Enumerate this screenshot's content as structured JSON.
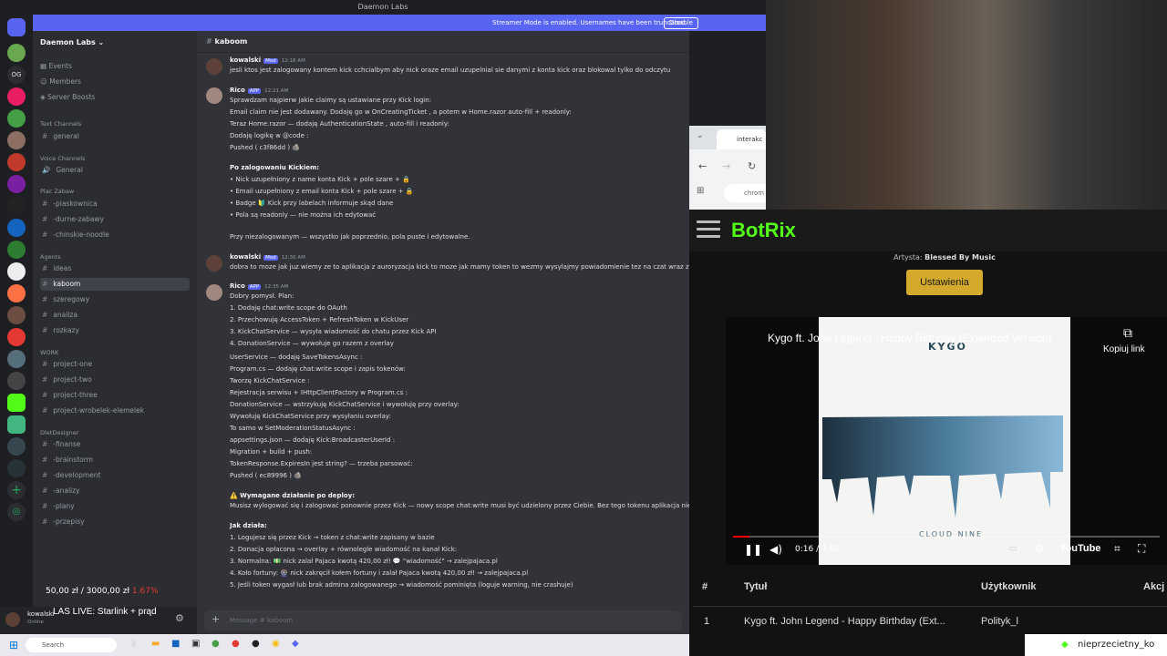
{
  "window": {
    "title": "Daemon Labs"
  },
  "banner": {
    "text": "Streamer Mode is enabled. Usernames have been truncated.",
    "button": "Disable"
  },
  "server": {
    "name": "Daemon Labs"
  },
  "nav": [
    "Events",
    "Members",
    "Server Boosts"
  ],
  "categories": {
    "text": "Text Channels",
    "voice": "Voice Channels",
    "plac": "Plac Zabaw",
    "agents": "Agents",
    "work": "WORK",
    "dlet": "DletDesigner"
  },
  "channels": {
    "general": "general",
    "voice_general": "General",
    "piaskownica": "-piaskownica",
    "durne": "-durne-zabawy",
    "chinskie": "-chinskie-noodle",
    "ideas": "ideas",
    "kaboom": "kaboom",
    "szeregowy": "szeregowy",
    "analiza": "analiza",
    "rozkazy": "rozkazy",
    "p1": "project-one",
    "p2": "project-two",
    "p3": "project-three",
    "p4": "project-wrobelek-elemelek",
    "finanse": "-finanse",
    "brainstorm": "-brainstorm",
    "development": "-development",
    "analizy": "-analizy",
    "plany": "-plany",
    "przepisy": "-przepisy"
  },
  "chat": {
    "channel": "kaboom",
    "placeholder": "Message # kaboom",
    "msgs": {
      "u1": "kowalski",
      "u1tag": "Mod",
      "t1": "12:18 AM",
      "l1": "jesli ktos jest zalogowany kontem kick cchcialbym aby nick oraze email uzupelnial sie danymi z konta kick  oraz blokowal tylko do odczytu",
      "u2": "Rico",
      "u2tag": "APP",
      "t2": "12:21 AM",
      "l2": "Sprawdzam najpierw jakie claimy są ustawiane przy Kick login:",
      "l3": "Email claim nie jest dodawany. Dodaję go w OnCreatingTicket , a potem w Home.razor auto-fill + readonly:",
      "l4": "Teraz Home.razor — dodaję AuthenticationState , auto-fill i readonly:",
      "l5": "Dodaję logikę w @code :",
      "l6": "Pushed ( c3f86dd ) 🪨",
      "l7": "Po zalogowaniu Kickiem:",
      "l8": "• Nick uzupełniony z name konta Kick + pole szare + 🔒",
      "l9": "• Email uzupełniony z email konta Kick + pole szare + 🔒",
      "l10": "• Badge 🔰 Kick przy labelach informuje skąd dane",
      "l11": "• Pola są readonly — nie można ich edytować",
      "l12": "Przy niezalogowanym — wszystko jak poprzednio, pola puste i edytowalne.",
      "t3": "12:30 AM",
      "l13": "dobra to moze jak juz wiemy ze to aplikacja z auroryzacja kick to moze jak mamy token to wezmy wysylajmy powiadomienie tez na czat wraz z wyswietl",
      "t4": "12:35 AM",
      "l14": "Dobry pomysł. Plan:",
      "l15": "1. Dodaję chat:write scope do OAuth",
      "l16": "2. Przechowuję AccessToken + RefreshToken w KickUser",
      "l17": "3. KickChatService — wysyła wiadomość do chatu przez Kick API",
      "l18": "4. DonationService — wywołuje go razem z overlay",
      "l19": "UserService — dodaję SaveTokensAsync :",
      "l20": "Program.cs — dodaję chat:write scope i zapis tokenów:",
      "l21": "Tworzę KickChatService :",
      "l22": "Rejestracja serwisu + IHttpClientFactory w Program.cs :",
      "l23": "DonationService — wstrzykuję KickChatService i wywołuję przy overlay:",
      "l24": "Wywołuję KickChatService przy wysyłaniu overlay:",
      "l25": "To samo w SetModerationStatusAsync :",
      "l26": "appsettings.json — dodaję Kick:BroadcasterUserId :",
      "l27": "Migration + build + push:",
      "l28": "TokenResponse.ExpiresIn jest string? — trzeba parsować:",
      "l29": "Pushed ( ec89996 ) 🪨",
      "l30": "⚠️ Wymagane działanie po deploy:",
      "l31": "Musisz wylogować się i zalogować ponownie przez Kick — nowy scope chat:write musi być udzielony przez Ciebie. Bez tego tokenu aplikacja nie m",
      "l32": "Jak działa:",
      "l33": "1. Logujesz się przez Kick → token z chat:write zapisany w bazie",
      "l34": "2. Donacja opłacona → overlay + równolegle wiadomość na kanał Kick:",
      "l35": "3. Normalna: 💵 nick zalał Pajaca kwotą 420,00 zł! 💬 \"wiadomość\" → zalejpajaca.pl",
      "l36": "4. Koło fortuny: 🎡 nick zakręcił kołem fortuny i zalał Pajaca kwotą 420,00 zł! → zalejpajaca.pl",
      "l37": "5. Jeśli token wygasł lub brak admina zalogowanego → wiadomość pominięta (loguje warning, nie crashuje)"
    }
  },
  "overlay": {
    "donation": "50,00 zł / 3000,00 zł",
    "donation_pct": "1.67%",
    "live": "LAS LIVE: Starlink + prąd",
    "user": "kowalski",
    "status": "Online"
  },
  "browser": {
    "tab": "interakc",
    "address": "chrom"
  },
  "botrix": {
    "logo": "BotRix",
    "artist_label": "Artysta:",
    "artist": "Blessed By Music",
    "settings": "Ustawienia",
    "video_title": "Kygo ft. John Legend - Happy Birthday (Extended Version)",
    "copy_link": "Kopiuj link",
    "time": "0:16 / 7:00",
    "progress": 0.038,
    "cover_text": "CLOUD NINE",
    "cover_logo": "KYGO",
    "yt": "YouTube",
    "cols": [
      "#",
      "Tytuł",
      "Użytkownik",
      "Akcj"
    ],
    "row": [
      "1",
      "Kygo ft. John Legend - Happy Birthday (Ext...",
      "Polityk_l"
    ]
  },
  "nick_badge": "nieprzecietny_ko",
  "taskbar": {
    "search": "Search"
  },
  "colors": {
    "accent": "#5865f2",
    "botrix": "#53fc18",
    "button": "#d4aa2c"
  }
}
